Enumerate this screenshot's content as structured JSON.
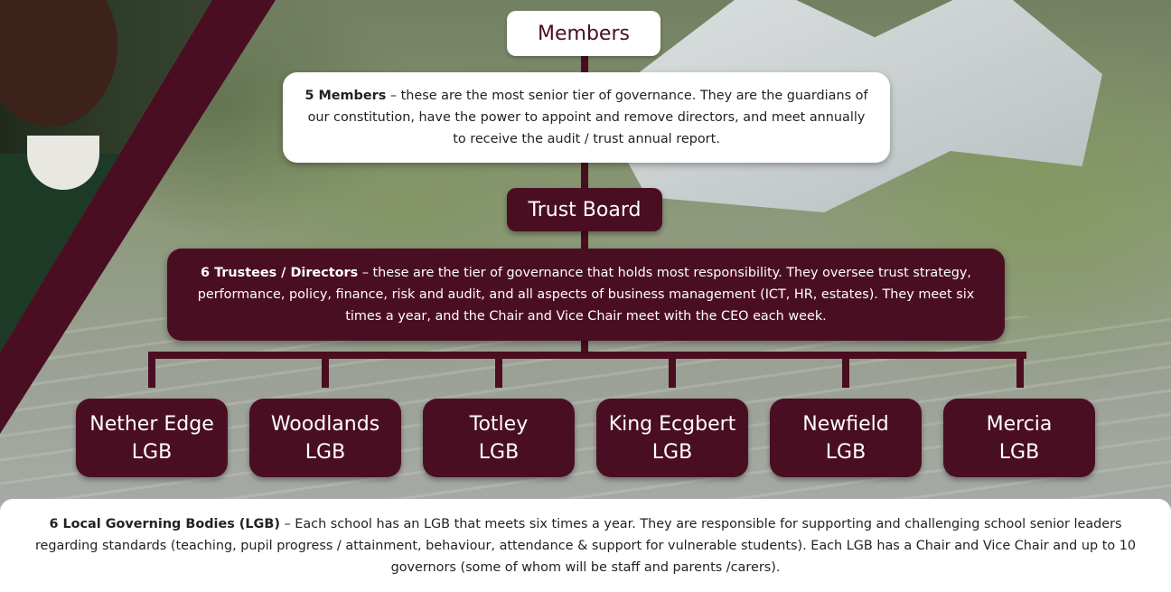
{
  "members": {
    "title": "Members",
    "desc_bold": "5 Members",
    "desc_text": " – these are the most senior tier of governance. They are the guardians of our constitution, have the power to appoint and remove directors, and meet annually to receive the audit / trust annual report."
  },
  "trust_board": {
    "title": "Trust Board",
    "desc_bold": "6 Trustees / Directors",
    "desc_text": " – these are the tier of governance that holds most responsibility. They oversee trust strategy, performance, policy, finance, risk and audit, and all aspects of business management (ICT, HR, estates). They meet six times a year, and the Chair and Vice Chair meet with the CEO each week."
  },
  "lgbs": [
    {
      "name": "Nether Edge",
      "suffix": "LGB"
    },
    {
      "name": "Woodlands",
      "suffix": "LGB"
    },
    {
      "name": "Totley",
      "suffix": "LGB"
    },
    {
      "name": "King Ecgbert",
      "suffix": "LGB"
    },
    {
      "name": "Newfield",
      "suffix": "LGB"
    },
    {
      "name": "Mercia",
      "suffix": "LGB"
    }
  ],
  "local_bodies": {
    "desc_bold": "6 Local Governing Bodies (LGB)",
    "desc_text": " – Each school has an LGB that meets six times a year. They are responsible for supporting and challenging school senior leaders regarding standards (teaching, pupil progress / attainment, behaviour, attendance & support for vulnerable students). Each LGB has a Chair and Vice Chair and up to 10 governors (some of whom will be staff and parents /carers)."
  },
  "colors": {
    "maroon": "#4a0e22",
    "white": "#ffffff"
  }
}
